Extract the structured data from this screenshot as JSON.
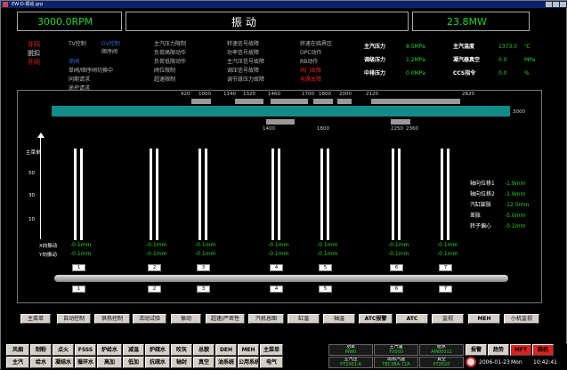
{
  "window": {
    "title": "EW-D-振动.grp"
  },
  "header": {
    "speed": "3000.0RPM",
    "title": "振      动",
    "power": "23.8MW"
  },
  "status": {
    "left": [
      "并网",
      "脱扣",
      "开网"
    ],
    "mid1": [
      "TV控制",
      "GV控制",
      "单阀",
      "单阀/顺序阀切换中",
      "同期请求",
      "遥控请求"
    ],
    "mid1b": "顺序阀",
    "mid2": [
      "主汽压力限制",
      "负荷高限动作",
      "负荷低限动作",
      "阀位限制",
      "超速限制"
    ],
    "mid3": [
      "转速信号故障",
      "功率信号故障",
      "主汽压信号故障",
      "调压信号故障",
      "调节级压力故障"
    ],
    "mid4": [
      "转速在临界区",
      "OPC动作",
      "RB动作",
      "阀门故障",
      "电路故障"
    ]
  },
  "params": [
    {
      "label": "主汽压力",
      "value": "8.5MPa"
    },
    {
      "label": "调级压力",
      "value": "1.2MPa"
    },
    {
      "label": "中排压力",
      "value": "0.0MPa"
    }
  ],
  "params2": [
    {
      "label": "主汽温度",
      "value": "1373.0",
      "unit": "℃"
    },
    {
      "label": "凝汽器真空",
      "value": "0.0",
      "unit": "MPa"
    },
    {
      "label": "CCS指令",
      "value": "0.0",
      "unit": "%"
    }
  ],
  "scale": {
    "top": [
      "920",
      "1000",
      "1140",
      "1320",
      "1460",
      "1700",
      "1800",
      "2000",
      "2120",
      "2820"
    ],
    "end": "3000",
    "bottom": [
      "1400",
      "1800",
      "2250",
      "2360"
    ]
  },
  "axis": {
    "labels": [
      "主菜单",
      "50",
      "30",
      "10"
    ]
  },
  "vib_labels": [
    "X向振动",
    "Y向振动"
  ],
  "bearings": [
    {
      "n": "1",
      "x": "-0.1mm",
      "y": "-0.1mm"
    },
    {
      "n": "2",
      "x": "-0.1mm",
      "y": "-0.1mm"
    },
    {
      "n": "3",
      "x": "-0.1mm",
      "y": "-0.1mm"
    },
    {
      "n": "4",
      "x": "-0.1mm",
      "y": "-0.1mm"
    },
    {
      "n": "5",
      "x": "-0.1mm",
      "y": "-0.1mm"
    },
    {
      "n": "6",
      "x": "-0.1mm",
      "y": "-0.1mm"
    },
    {
      "n": "7",
      "x": "-0.1mm",
      "y": "-0.1mm"
    }
  ],
  "axial": [
    {
      "label": "轴向位移1",
      "value": "-1.9mm"
    },
    {
      "label": "轴向位移2",
      "value": "-1.9mm"
    },
    {
      "label": "汽缸膨胀",
      "value": "-12.5mm"
    },
    {
      "label": "差胀",
      "value": "-5.0mm"
    },
    {
      "label": "转子偏心",
      "value": "-0.1mm"
    }
  ],
  "buttons": [
    "主菜单",
    "自动控制",
    "供热控制",
    "活动试验",
    "振动",
    "超速/严密性",
    "汽机总图",
    "缸温",
    "轴温",
    "ATC报警",
    "ATC",
    "监视",
    "MEH",
    "小机监视"
  ],
  "taskbar": {
    "row1": [
      "风烟",
      "制粉",
      "点火",
      "FSSS",
      "炉给水",
      "减温",
      "炉疏水",
      "吹灰",
      "总貌",
      "DEH",
      "MEH",
      "主菜单"
    ],
    "row2": [
      "主汽",
      "给水",
      "凝结水",
      "循环水",
      "高加",
      "低加",
      "抗疏水",
      "轴封",
      "真空",
      "油系统",
      "公用系统",
      "电气"
    ],
    "cells": [
      {
        "a": "功率",
        "b": "MW0"
      },
      {
        "a": "主汽温",
        "b": "T0000"
      },
      {
        "a": "给水",
        "b": "AM00011"
      },
      {
        "a": "主汽压",
        "b": "PT2001-6"
      },
      {
        "a": "再热汽温",
        "b": "TEC3BA-72A"
      },
      {
        "a": "真空",
        "b": "PT2620"
      }
    ],
    "right": [
      "报警",
      "趋势",
      "MFT",
      "跳机"
    ],
    "date": "2006-01-23",
    "day": "Mon",
    "time": "10:42:41"
  },
  "colors": {
    "green": "#28d328",
    "red": "#e02020",
    "blue": "#2b6bd6",
    "teal": "#138a8a"
  }
}
